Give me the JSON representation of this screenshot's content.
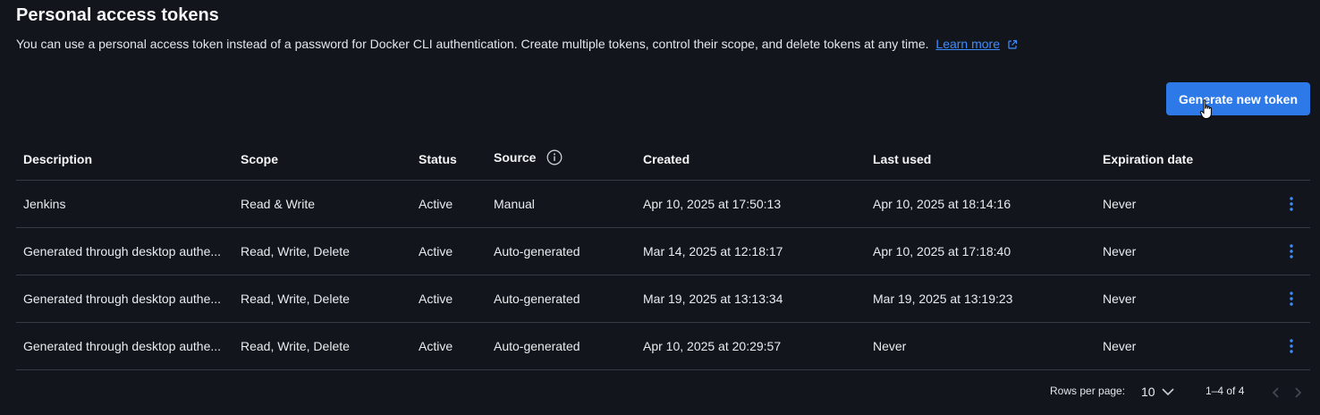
{
  "header": {
    "title": "Personal access tokens",
    "description": "You can use a personal access token instead of a password for Docker CLI authentication. Create multiple tokens, control their scope, and delete tokens at any time.",
    "learn_more": "Learn more"
  },
  "actions": {
    "generate_label": "Generate new token"
  },
  "table": {
    "columns": [
      "Description",
      "Scope",
      "Status",
      "Source",
      "Created",
      "Last used",
      "Expiration date"
    ],
    "rows": [
      {
        "description": "Jenkins",
        "scope": "Read & Write",
        "status": "Active",
        "source": "Manual",
        "created": "Apr 10, 2025 at 17:50:13",
        "last_used": "Apr 10, 2025 at 18:14:16",
        "expiration": "Never"
      },
      {
        "description": "Generated through desktop authe...",
        "scope": "Read, Write, Delete",
        "status": "Active",
        "source": "Auto-generated",
        "created": "Mar 14, 2025 at 12:18:17",
        "last_used": "Apr 10, 2025 at 17:18:40",
        "expiration": "Never"
      },
      {
        "description": "Generated through desktop authe...",
        "scope": "Read, Write, Delete",
        "status": "Active",
        "source": "Auto-generated",
        "created": "Mar 19, 2025 at 13:13:34",
        "last_used": "Mar 19, 2025 at 13:19:23",
        "expiration": "Never"
      },
      {
        "description": "Generated through desktop authe...",
        "scope": "Read, Write, Delete",
        "status": "Active",
        "source": "Auto-generated",
        "created": "Apr 10, 2025 at 20:29:57",
        "last_used": "Never",
        "expiration": "Never"
      }
    ]
  },
  "pagination": {
    "rows_per_page_label": "Rows per page:",
    "rows_per_page_value": "10",
    "range": "1–4 of 4"
  },
  "colors": {
    "background": "#12161c",
    "accent": "#2e79e8",
    "link": "#3f8cff",
    "divider": "#353b44"
  },
  "icons": {
    "external_link": "external-link-icon",
    "info": "info-icon",
    "row_menu": "kebab-menu-icon",
    "dropdown": "chevron-down-icon",
    "prev": "chevron-left-icon",
    "next": "chevron-right-icon"
  }
}
